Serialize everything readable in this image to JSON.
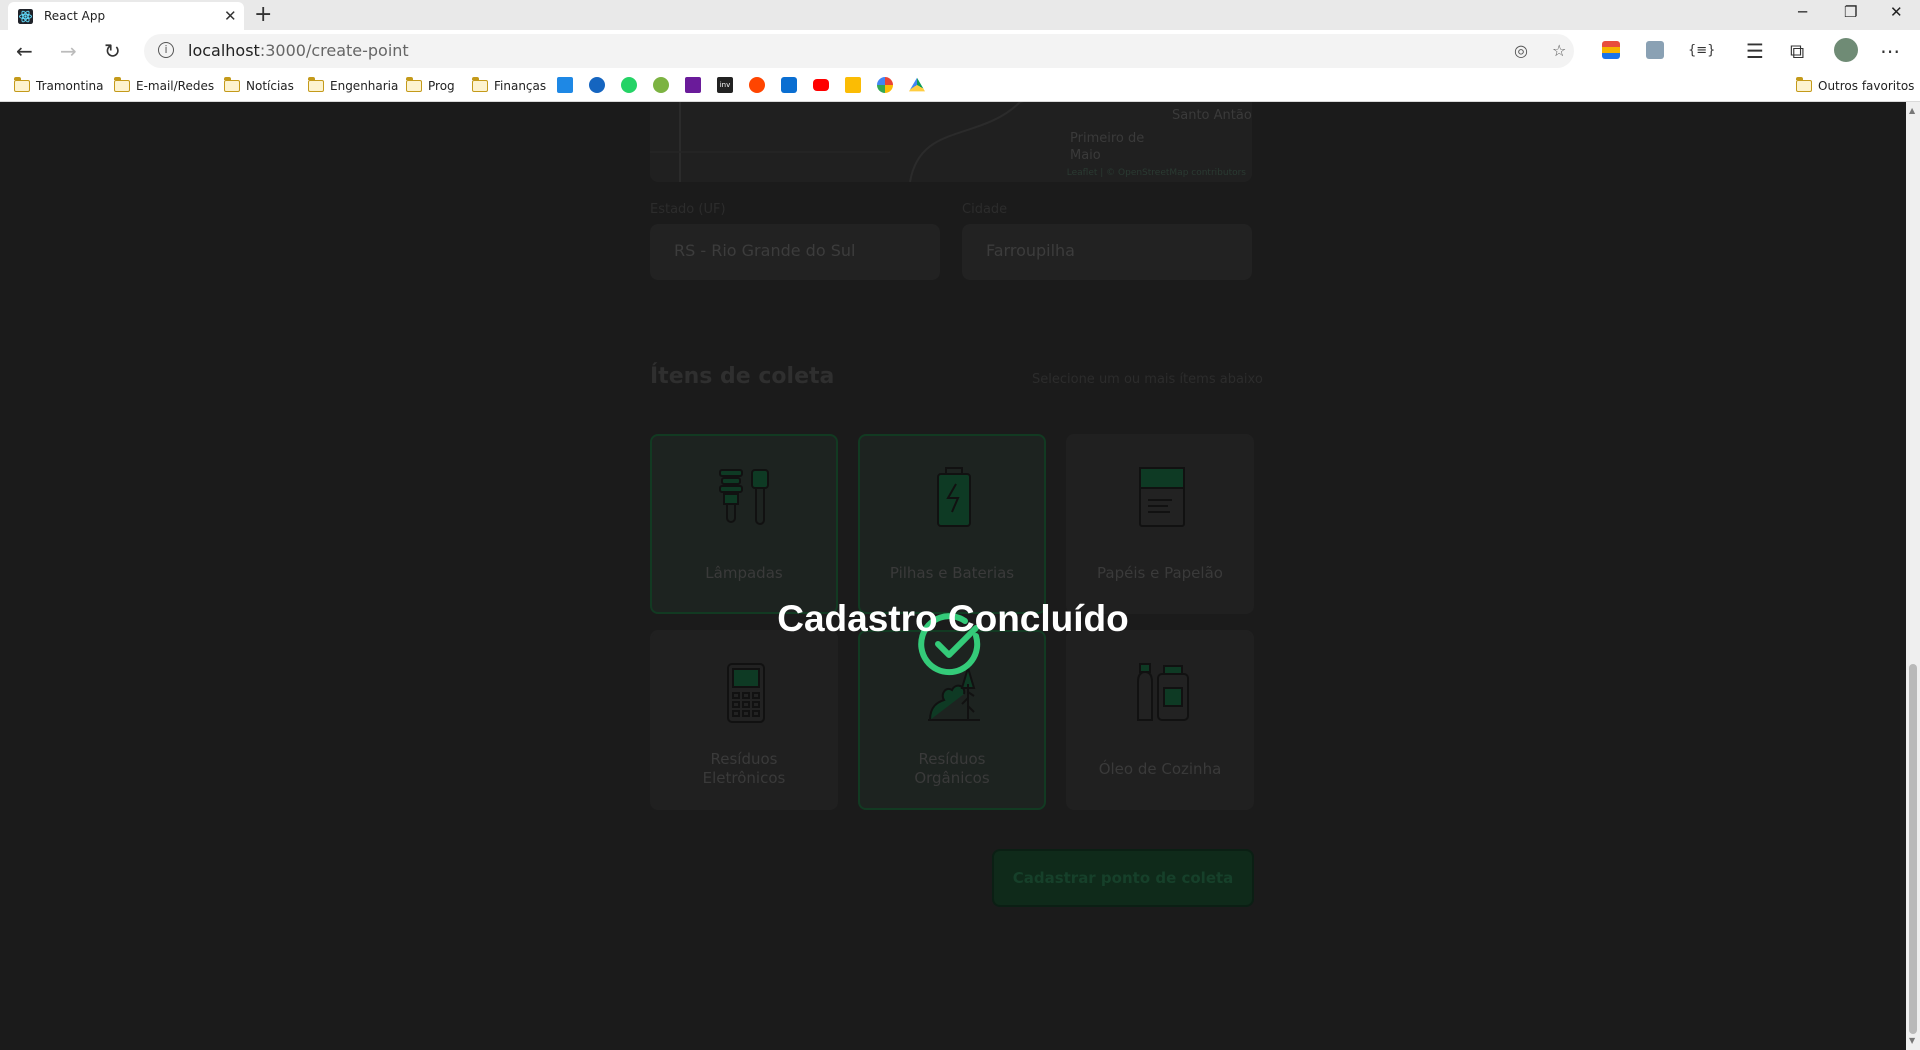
{
  "browser": {
    "tab_title": "React App",
    "url_host": "localhost",
    "url_path": ":3000/create-point",
    "bookmarks": [
      "Tramontina",
      "E-mail/Redes",
      "Notícias",
      "Engenharia",
      "Prog",
      "Finanças"
    ],
    "other_bookmarks": "Outros favoritos",
    "favicon_icons": [
      "check-icon",
      "lifebuoy-icon",
      "whatsapp-icon",
      "money-icon",
      "book-icon",
      "inv-icon",
      "reddit-icon",
      "app-icon",
      "youtube-icon",
      "keep-icon",
      "google-icon",
      "drive-icon"
    ],
    "inv_label": "inv"
  },
  "map": {
    "place_labels": [
      "Santo Antão",
      "Primeiro de Maio"
    ],
    "attribution": "Leaflet | © OpenStreetMap contributors"
  },
  "form": {
    "uf_label": "Estado (UF)",
    "uf_value": "RS - Rio Grande do Sul",
    "city_label": "Cidade",
    "city_value": "Farroupilha"
  },
  "items": {
    "title": "Ítens de coleta",
    "hint": "Selecione um ou mais ítems abaixo",
    "cards": [
      {
        "label_1": "Lâmpadas",
        "label_2": "",
        "selected": true,
        "icon": "lamp-icon"
      },
      {
        "label_1": "Pilhas e Baterias",
        "label_2": "",
        "selected": true,
        "icon": "battery-icon"
      },
      {
        "label_1": "Papéis e Papelão",
        "label_2": "",
        "selected": false,
        "icon": "paper-icon"
      },
      {
        "label_1": "Resíduos",
        "label_2": "Eletrônicos",
        "selected": false,
        "icon": "electronics-icon"
      },
      {
        "label_1": "Resíduos",
        "label_2": "Orgânicos",
        "selected": true,
        "icon": "organic-icon"
      },
      {
        "label_1": "Óleo de Cozinha",
        "label_2": "",
        "selected": false,
        "icon": "oil-icon"
      }
    ]
  },
  "submit_label": "Cadastrar ponto de coleta",
  "overlay": {
    "title": "Cadastro Concluído",
    "icon": "check-circle-icon",
    "accent": "#34cb79"
  }
}
